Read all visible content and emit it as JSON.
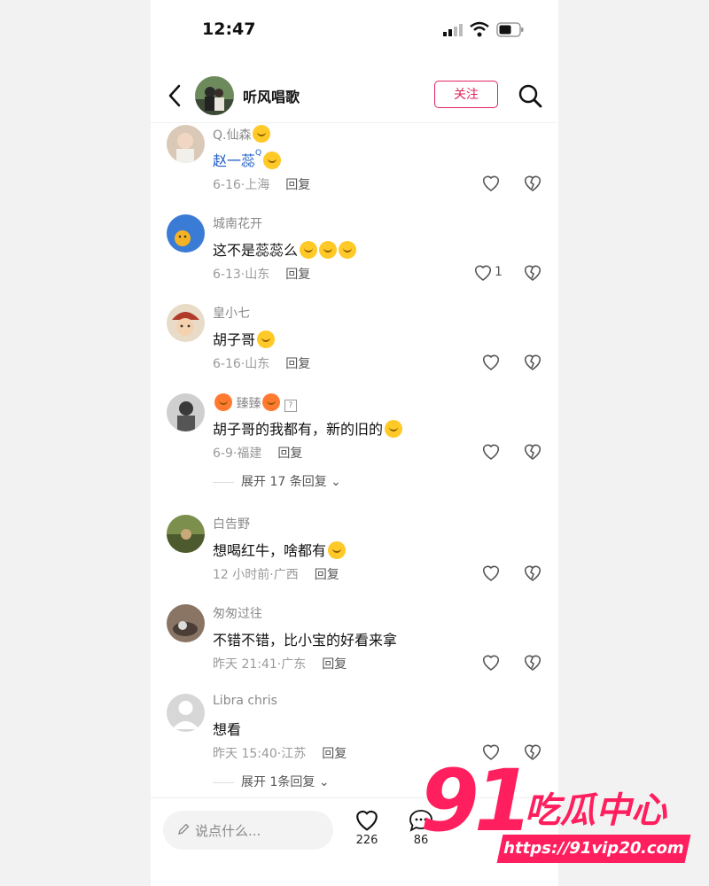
{
  "status_bar": {
    "time": "12:47"
  },
  "header": {
    "author_name": "听风唱歌",
    "follow_label": "关注"
  },
  "comments": [
    {
      "user": "Q.仙森",
      "text": "赵一蕊",
      "date": "6-16",
      "location": "上海",
      "reply": "回复"
    },
    {
      "user": "城南花开",
      "text": "这不是蕊蕊么",
      "date": "6-13",
      "location": "山东",
      "reply": "回复",
      "likes": "1"
    },
    {
      "user": "皇小七",
      "text": "胡子哥",
      "date": "6-16",
      "location": "山东",
      "reply": "回复"
    },
    {
      "user": "臻臻",
      "text": "胡子哥的我都有，新的旧的",
      "date": "6-9",
      "location": "福建",
      "reply": "回复",
      "expand": "展开 17 条回复"
    },
    {
      "user": "白告野",
      "text": "想喝红牛，啥都有",
      "date": "12 小时前",
      "location": "广西",
      "reply": "回复"
    },
    {
      "user": "匆匆过往",
      "text": "不错不错，比小宝的好看来拿",
      "date": "昨天 21:41",
      "location": "广东",
      "reply": "回复"
    },
    {
      "user": "Libra chris",
      "text": "想看",
      "date": "昨天 15:40",
      "location": "江苏",
      "reply": "回复",
      "expand": "展开 1条回复"
    }
  ],
  "bottom_bar": {
    "input_placeholder": "说点什么...",
    "likes": "226",
    "comments": "86"
  },
  "watermark": {
    "brand": "91",
    "title": "吃瓜中心",
    "url": "https://91vip20.com"
  },
  "colors": {
    "accent": "#e0245e",
    "watermark": "#ff1f5e"
  },
  "icons": [
    "back-icon",
    "search-icon",
    "heart-icon",
    "broken-heart-icon",
    "comment-icon",
    "pen-icon"
  ]
}
